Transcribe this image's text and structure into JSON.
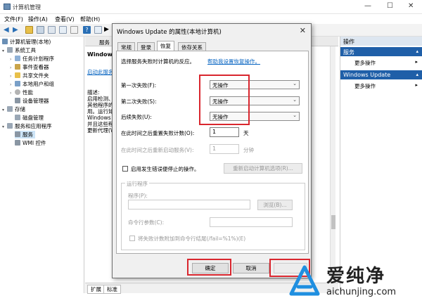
{
  "window": {
    "title": "计算机管理"
  },
  "menu": [
    "文件(F)",
    "操作(A)",
    "查看(V)",
    "帮助(H)"
  ],
  "tree": {
    "items": [
      {
        "label": "计算机管理(本地)",
        "level": 0
      },
      {
        "label": "系统工具",
        "level": 1
      },
      {
        "label": "任务计划程序",
        "level": 2
      },
      {
        "label": "事件查看器",
        "level": 2
      },
      {
        "label": "共享文件夹",
        "level": 2
      },
      {
        "label": "本地用户和组",
        "level": 2
      },
      {
        "label": "性能",
        "level": 2
      },
      {
        "label": "设备管理器",
        "level": 2
      },
      {
        "label": "存储",
        "level": 1
      },
      {
        "label": "磁盘管理",
        "level": 2
      },
      {
        "label": "服务和应用程序",
        "level": 1
      },
      {
        "label": "服务",
        "level": 2
      },
      {
        "label": "WMI 控件",
        "level": 2
      }
    ]
  },
  "center": {
    "header": "服务",
    "service_name": "Windows",
    "start_link": "启动此服务",
    "desc_lines": [
      "描述:",
      "启用检测、",
      "其他程序的",
      "用。运行如",
      "Windows",
      "并且这些程",
      "更新代理(W"
    ]
  },
  "bottom_tabs": [
    "扩展",
    "标准"
  ],
  "actions": {
    "header": "操作",
    "section1": "服务",
    "item1": "更多操作",
    "section2": "Windows Update",
    "item2": "更多操作"
  },
  "dialog": {
    "title": "Windows Update 的属性(本地计算机)",
    "tabs": [
      "常规",
      "登录",
      "恢复",
      "依存关系"
    ],
    "active_tab": "恢复",
    "intro": "选择服务失败时计算机的反应。",
    "help_link": "帮助我设置恢复操作。",
    "first_failure_label": "第一次失败(F):",
    "first_failure_value": "无操作",
    "second_failure_label": "第二次失败(S):",
    "second_failure_value": "无操作",
    "subsequent_failure_label": "后续失败(U):",
    "subsequent_failure_value": "无操作",
    "reset_after_label": "在此时间之后重置失败计数(O):",
    "reset_after_value": "1",
    "reset_unit": "天",
    "restart_after_label": "在此时间之后重新启动服务(V):",
    "restart_after_value": "1",
    "restart_unit": "分钟",
    "enable_actions_label": "启用发生错误便停止的操作。",
    "restart_options_button": "重新启动计算机选项(R)...",
    "run_program_group": "运行程序",
    "program_label": "程序(P):",
    "browse_button": "浏览(B)...",
    "cmd_params_label": "命令行参数(C):",
    "append_fail_label": "将失败计数附加到命令行结尾(/fail=%1%)(E)",
    "ok_button": "确定",
    "cancel_button": "取消"
  },
  "watermark": {
    "brand": "爱纯净",
    "url": "aichunjing.com",
    "colors": {
      "logo": "#1f8fe0",
      "text": "#222222"
    }
  },
  "colors": {
    "highlight": "#d9262e",
    "link": "#0a66c2",
    "selection": "#cce4f7"
  }
}
